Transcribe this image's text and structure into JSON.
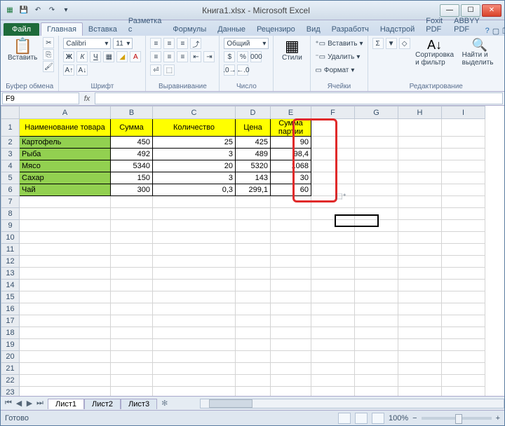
{
  "title": "Книга1.xlsx - Microsoft Excel",
  "tabs": {
    "file": "Файл",
    "home": "Главная",
    "insert": "Вставка",
    "layout": "Разметка с",
    "formulas": "Формулы",
    "data": "Данные",
    "review": "Рецензиро",
    "view": "Вид",
    "dev": "Разработч",
    "addins": "Надстрой",
    "foxit": "Foxit PDF",
    "abbyy": "ABBYY PDF"
  },
  "groups": {
    "clipboard": {
      "label": "Буфер обмена",
      "paste": "Вставить"
    },
    "font": {
      "label": "Шрифт",
      "name": "Calibri",
      "size": "11"
    },
    "alignment": {
      "label": "Выравнивание"
    },
    "number": {
      "label": "Число",
      "format": "Общий"
    },
    "styles": {
      "label": "Стили",
      "btn": "Стили"
    },
    "cells": {
      "label": "Ячейки",
      "insert": "Вставить",
      "delete": "Удалить",
      "format": "Формат"
    },
    "editing": {
      "label": "Редактирование",
      "sort": "Сортировка и фильтр",
      "find": "Найти и выделить"
    }
  },
  "nameBox": "F9",
  "columns": [
    "A",
    "B",
    "C",
    "D",
    "E",
    "F",
    "G",
    "H",
    "I"
  ],
  "rowCount": 23,
  "headers": {
    "a": "Наименование товара",
    "b": "Сумма",
    "c": "Количество",
    "d": "Цена",
    "e": "Сумма партии"
  },
  "dataRows": [
    {
      "name": "Картофель",
      "sum": "450",
      "qty": "25",
      "price": "425",
      "batch": "90"
    },
    {
      "name": "Рыба",
      "sum": "492",
      "qty": "3",
      "price": "489",
      "batch": "98,4"
    },
    {
      "name": "Мясо",
      "sum": "5340",
      "qty": "20",
      "price": "5320",
      "batch": "1068"
    },
    {
      "name": "Сахар",
      "sum": "150",
      "qty": "3",
      "price": "143",
      "batch": "30"
    },
    {
      "name": "Чай",
      "sum": "300",
      "qty": "0,3",
      "price": "299,1",
      "batch": "60"
    }
  ],
  "sheets": [
    "Лист1",
    "Лист2",
    "Лист3"
  ],
  "status": "Готово",
  "zoom": "100%",
  "chart_data": {
    "type": "table",
    "title": "Сумма партии",
    "headers": [
      "Наименование товара",
      "Сумма",
      "Количество",
      "Цена",
      "Сумма партии"
    ],
    "rows": [
      [
        "Картофель",
        450,
        25,
        425,
        90
      ],
      [
        "Рыба",
        492,
        3,
        489,
        98.4
      ],
      [
        "Мясо",
        5340,
        20,
        5320,
        1068
      ],
      [
        "Сахар",
        150,
        3,
        143,
        30
      ],
      [
        "Чай",
        300,
        0.3,
        299.1,
        60
      ]
    ]
  }
}
